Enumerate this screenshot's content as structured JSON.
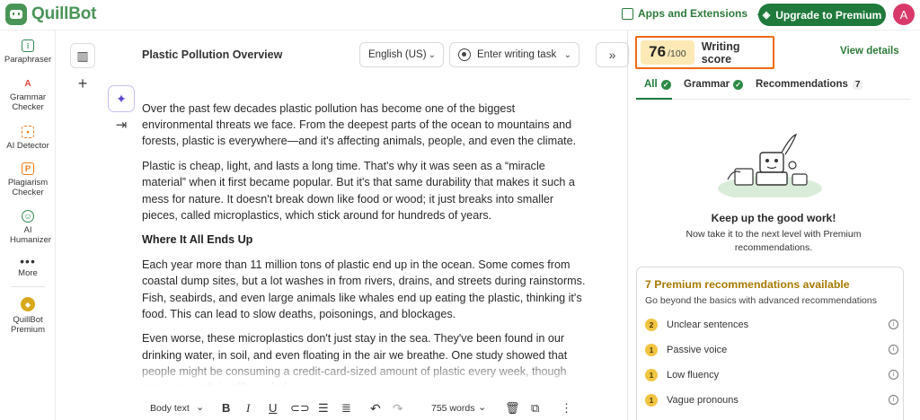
{
  "brand": {
    "name": "QuillBot"
  },
  "header": {
    "apps_label": "Apps and Extensions",
    "upgrade_label": "Upgrade to Premium",
    "avatar_initial": "A"
  },
  "sidebar": {
    "items": [
      {
        "label": "Paraphraser",
        "icon": "paraphraser-icon",
        "color": "#2e8b57"
      },
      {
        "label": "Grammar Checker",
        "icon": "grammar-icon",
        "color": "#e0463c"
      },
      {
        "label": "AI Detector",
        "icon": "ai-detector-icon",
        "color": "#f07a1a"
      },
      {
        "label": "Plagiarism Checker",
        "icon": "plagiarism-icon",
        "color": "#f07a1a"
      },
      {
        "label": "AI Humanizer",
        "icon": "humanizer-icon",
        "color": "#2e8b57"
      },
      {
        "label": "More",
        "icon": "more-dots-icon"
      },
      {
        "label": "QuillBot Premium",
        "icon": "premium-diamond-icon",
        "color": "#d8a81c"
      }
    ]
  },
  "editor": {
    "title": "Plastic Pollution Overview",
    "language": "English (US)",
    "task_placeholder": "Enter writing task",
    "paragraphs": [
      "Over the past few decades plastic pollution has become one of the biggest environmental threats we face. From the deepest parts of the ocean to mountains and forests, plastic is everywhere—and it's affecting animals, people, and even the climate.",
      "Plastic is cheap, light, and lasts a long time. That's why it was seen as a “miracle material” when it first became popular. But it's that same durability that makes it such a mess for nature. It doesn't break down like food or wood; it just breaks into smaller pieces, called microplastics, which stick around for hundreds of years."
    ],
    "heading": "Where It All Ends Up",
    "paragraphs2": [
      "Each year more than 11 million tons of plastic end up in the ocean. Some comes from coastal dump sites, but a lot washes in from rivers, drains, and streets during rainstorms. Fish, seabirds, and even large animals like whales end up eating the plastic, thinking it's food. This can lead to slow deaths, poisonings, and blockages.",
      "Even worse, these microplastics don't just stay in the sea. They've been found in our drinking water, in soil, and even floating in the air we breathe. One study showed that people might be consuming a credit-card-sized amount of plastic every week, though more research is still needed."
    ]
  },
  "toolbar": {
    "style_label": "Body text",
    "bold": "B",
    "italic": "I",
    "underline": "U",
    "word_count": "755 words"
  },
  "panel": {
    "score": "76",
    "score_max": "/100",
    "score_label": "Writing score",
    "view_details": "View details",
    "tabs": [
      {
        "label": "All"
      },
      {
        "label": "Grammar"
      },
      {
        "label": "Recommendations",
        "count": "7"
      }
    ],
    "good_title": "Keep up the good work!",
    "good_sub": "Now take it to the next level with Premium recommendations.",
    "premium_title": "7 Premium recommendations available",
    "premium_sub": "Go beyond the basics with advanced recommendations",
    "recommendations": [
      {
        "count": "2",
        "label": "Unclear sentences"
      },
      {
        "count": "1",
        "label": "Passive voice"
      },
      {
        "count": "1",
        "label": "Low fluency"
      },
      {
        "count": "1",
        "label": "Vague pronouns"
      }
    ]
  },
  "colors": {
    "brand_green": "#499557",
    "upgrade_green": "#1f7a3c",
    "score_highlight": "#f06a16",
    "premium_gold": "#a87a00"
  }
}
